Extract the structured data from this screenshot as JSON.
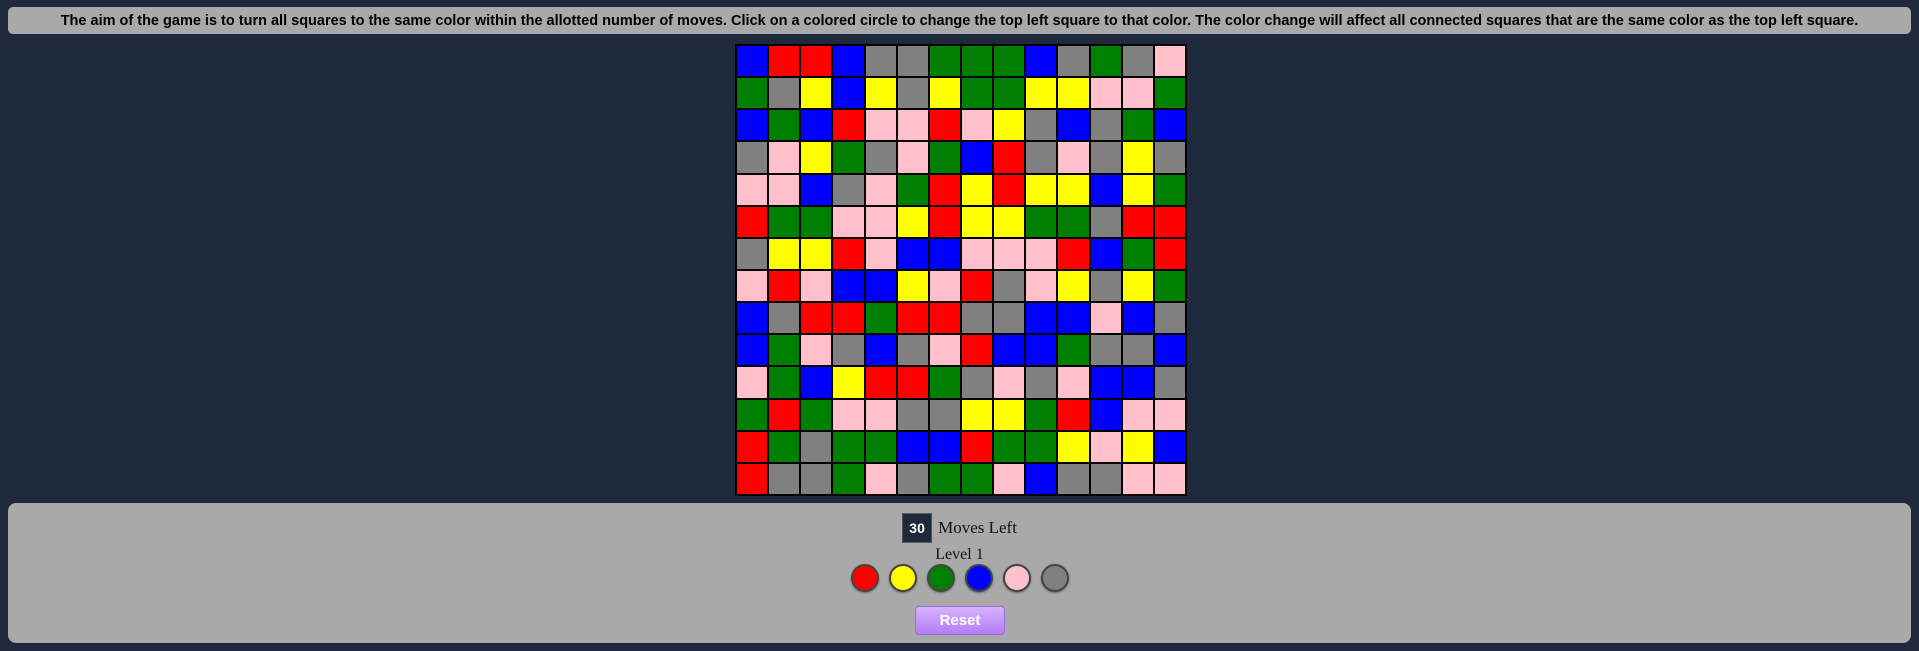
{
  "instructions": "The aim of the game is to turn all squares to the same color within the allotted number of moves. Click on a colored circle to change the top left square to that color. The color change will affect all connected squares that are the same color as the top left square.",
  "colors": {
    "R": "#ff0000",
    "Y": "#ffff00",
    "G": "#008000",
    "B": "#0000ff",
    "P": "#ffc0cb",
    "A": "#808080"
  },
  "board": [
    [
      "B",
      "R",
      "R",
      "B",
      "A",
      "A",
      "G",
      "G",
      "G",
      "B",
      "A",
      "G",
      "A",
      "P"
    ],
    [
      "G",
      "A",
      "Y",
      "B",
      "Y",
      "A",
      "Y",
      "G",
      "G",
      "Y",
      "Y",
      "P",
      "P",
      "G"
    ],
    [
      "B",
      "G",
      "B",
      "R",
      "P",
      "P",
      "R",
      "P",
      "Y",
      "A",
      "B",
      "A",
      "G",
      "B"
    ],
    [
      "A",
      "P",
      "Y",
      "G",
      "A",
      "P",
      "G",
      "B",
      "R",
      "A",
      "P",
      "A",
      "Y",
      "A"
    ],
    [
      "P",
      "P",
      "B",
      "A",
      "P",
      "G",
      "R",
      "Y",
      "R",
      "Y",
      "Y",
      "B",
      "Y",
      "G"
    ],
    [
      "R",
      "G",
      "G",
      "P",
      "P",
      "Y",
      "R",
      "Y",
      "Y",
      "G",
      "G",
      "A",
      "R",
      "R"
    ],
    [
      "A",
      "Y",
      "Y",
      "R",
      "P",
      "B",
      "B",
      "P",
      "P",
      "P",
      "R",
      "B",
      "G",
      "R"
    ],
    [
      "P",
      "R",
      "P",
      "B",
      "B",
      "Y",
      "P",
      "R",
      "A",
      "P",
      "Y",
      "A",
      "Y",
      "G"
    ],
    [
      "B",
      "A",
      "R",
      "R",
      "G",
      "R",
      "R",
      "A",
      "A",
      "B",
      "B",
      "P",
      "B",
      "A"
    ],
    [
      "B",
      "G",
      "P",
      "A",
      "B",
      "A",
      "P",
      "R",
      "B",
      "B",
      "G",
      "A",
      "A",
      "B"
    ],
    [
      "P",
      "G",
      "B",
      "Y",
      "R",
      "R",
      "G",
      "A",
      "P",
      "A",
      "P",
      "B",
      "B",
      "A"
    ],
    [
      "G",
      "R",
      "G",
      "P",
      "P",
      "A",
      "A",
      "Y",
      "Y",
      "G",
      "R",
      "B",
      "P",
      "P"
    ],
    [
      "R",
      "G",
      "A",
      "G",
      "G",
      "B",
      "B",
      "R",
      "G",
      "G",
      "Y",
      "P",
      "Y",
      "B"
    ],
    [
      "R",
      "A",
      "A",
      "G",
      "P",
      "A",
      "G",
      "G",
      "P",
      "B",
      "A",
      "A",
      "P",
      "P"
    ]
  ],
  "moves": {
    "count": "30",
    "label": "Moves Left"
  },
  "level": "Level 1",
  "palette": [
    {
      "name": "red",
      "code": "R"
    },
    {
      "name": "yellow",
      "code": "Y"
    },
    {
      "name": "green",
      "code": "G"
    },
    {
      "name": "blue",
      "code": "B"
    },
    {
      "name": "pink",
      "code": "P"
    },
    {
      "name": "gray",
      "code": "A"
    }
  ],
  "reset_label": "Reset"
}
